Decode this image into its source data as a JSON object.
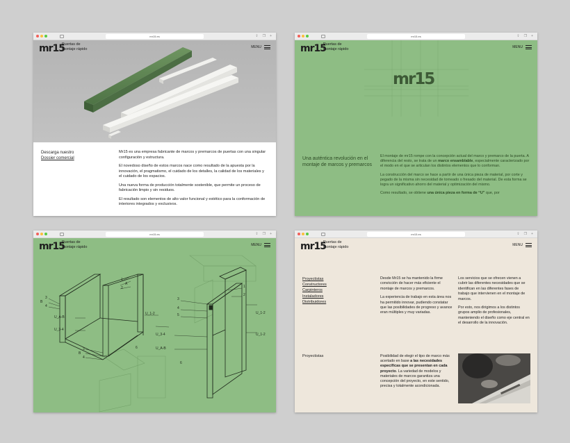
{
  "browser": {
    "url": "mr15.es"
  },
  "brand": {
    "logo": "mr15",
    "tagline_line1": "Puertas de",
    "tagline_line2": "montaje rápido",
    "menu_label": "MENU"
  },
  "window1": {
    "download_line1": "Descarga nuestro",
    "download_link": "Dossier comercial",
    "paragraphs": [
      "Mr15 es una empresa fabricante de marcos y premarcos de puertas con una singular configuración y estructura.",
      "El novedoso diseño de estos marcos nace como resultado de la apuesta por la innovación, el pragmatismo, el cuidado de los detalles, la calidad de los materiales y el cuidado de los espacios.",
      "Una nueva forma de producción totalmente sostenible, que permite un proceso de fabricación limpio y sin residuos.",
      "El resultado son elementos de alto valor funcional y estético para la conformación de interiores integrados y exclusivos."
    ]
  },
  "window2": {
    "big_logo": "mr15",
    "heading": "Una auténtica revolución en el montaje de marcos y premarcos",
    "p1_before": "El montaje de mr15 rompe con la concepción actual del marco y premarco de la puerta. A diferencia del resto, se trata de un ",
    "p1_bold": "marco ensamblable",
    "p1_after": ", especialmente caracterizado por el modo en el que se articulan los distintos elementos que lo conforman.",
    "p2": "La construcción del marco se hace a partir de una única pieza de material, por corte y pegado de la misma sin necesidad de torneado o fresado del material. De esta forma se logra un significativo ahorro del material y optimización del mismo.",
    "p3_before": "Como resultado, se obtiene ",
    "p3_bold": "una única pieza en forma de “U”",
    "p3_after": " que, por"
  },
  "window3": {
    "labels": {
      "one": "1",
      "two": "2",
      "three": "3",
      "four": "4",
      "five": "5",
      "six": "6",
      "a": "A",
      "b": "B",
      "u12": "U_1-2",
      "u34": "U_3-4",
      "uab": "U_A-B"
    }
  },
  "window4": {
    "links": [
      "Proyectistas",
      "Constructores",
      "Carpinteros",
      "Instaladores",
      "Distribuidores"
    ],
    "col2": [
      "Desde Mr15 se ha mantenido la firme convicción de hacer más eficiente el montaje de marcos y premarcos.",
      "La experiencia de trabajo en esta área nos ha permitido innovar, pudiendo constatar que las posibilidades de progreso y avance eran múltiples y muy variadas."
    ],
    "col3": [
      "Los servicios que se ofrecen vienen a cubrir las diferentes necesidades que se identifican en las diferentes fases de trabajo que intervienen en el montaje de marcos.",
      "Por esto, nos dirigimos a los distintos grupos amplio de profesionales, manteniendo el diseño como eje central en el desarrollo de la innovación."
    ],
    "section_label": "Proyectistas",
    "section_before": "Posibilidad de elegir el tipo de marco más acertado en base ",
    "section_bold": "a las necesidades específicas que se presentan en cada proyecto",
    "section_after": ". La variedad de modelos y materiales de marcos garantiza una concepción del proyecto, en este sentido, precisa y totalmente acondicionada."
  },
  "colors": {
    "green": "#8ebd84",
    "cream": "#eee7dc",
    "dark_green": "#3d5a36"
  }
}
